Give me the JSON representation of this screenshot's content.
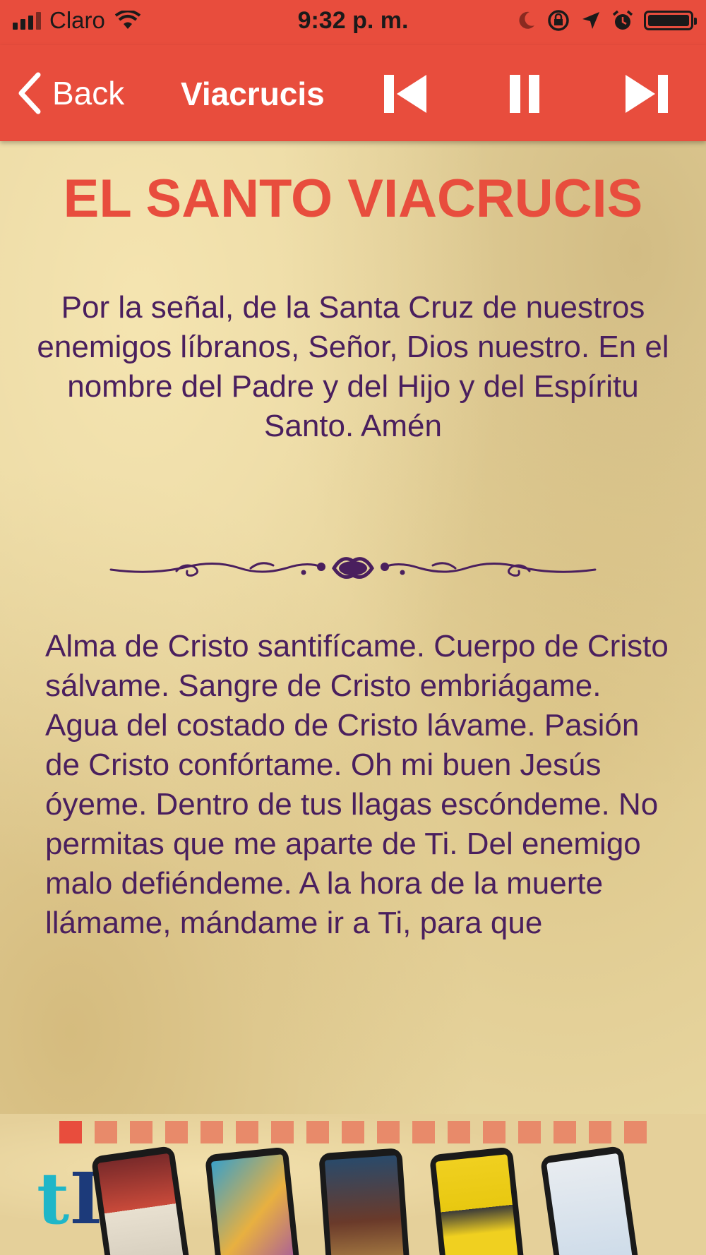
{
  "status_bar": {
    "carrier": "Claro",
    "time": "9:32 p. m."
  },
  "nav": {
    "back_label": "Back",
    "title": "Viacrucis"
  },
  "content": {
    "title": "EL SANTO VIACRUCIS",
    "intro_prayer": "Por la señal, de la Santa Cruz de nuestros enemigos líbranos, Señor, Dios nuestro. En el nombre del Padre y del Hijo y del Espíritu Santo. Amén",
    "main_prayer": "Alma de Cristo santifícame. Cuerpo de Cristo sálvame. Sangre de Cristo embriágame. Agua del costado de Cristo lávame. Pasión de Cristo confórtame. Oh mi buen Jesús óyeme. Dentro de tus llagas escóndeme. No permitas que me aparte de Ti. Del enemigo malo defiéndeme. A la hora de la muerte llámame, mándame ir a Ti, para que"
  },
  "ad": {
    "logo_text": "tI",
    "dot_count": 17,
    "active_dot": 0
  },
  "colors": {
    "accent": "#e84d3d",
    "text": "#4a1f5e",
    "parchment": "#e8d6a0"
  },
  "icons": [
    "signal-icon",
    "wifi-icon",
    "moon-icon",
    "rotation-lock-icon",
    "location-icon",
    "alarm-icon",
    "battery-icon",
    "chevron-left-icon",
    "skip-previous-icon",
    "pause-icon",
    "skip-next-icon"
  ]
}
